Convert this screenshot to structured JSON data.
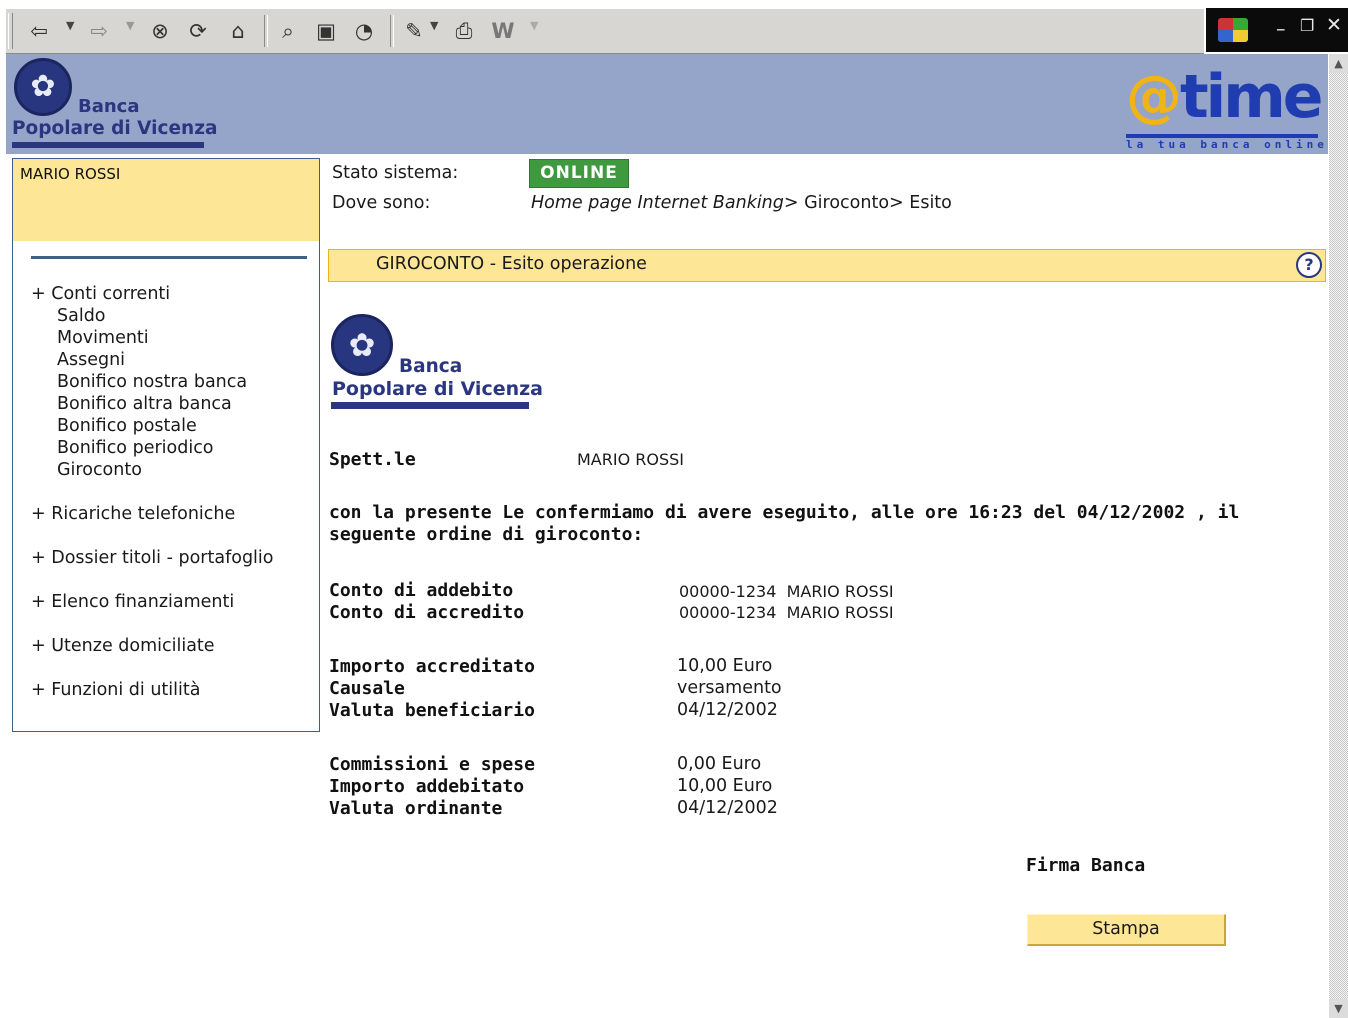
{
  "toolbar": {
    "icons": [
      "back-arrow-icon",
      "forward-arrow-icon",
      "stop-icon",
      "refresh-icon",
      "home-icon",
      "search-icon",
      "favorites-icon",
      "history-icon",
      "edit-icon",
      "print-icon",
      "word-icon"
    ]
  },
  "header": {
    "bank_word": "Banca",
    "bank_name": "Popolare di Vicenza",
    "brand_at": "@",
    "brand_time": "time",
    "brand_tagline": "la tua banca online"
  },
  "sidebar": {
    "user_name": "MARIO ROSSI",
    "groups": [
      {
        "label": "+ Conti correnti",
        "items": [
          "Saldo",
          "Movimenti",
          "Assegni",
          "Bonifico nostra banca",
          "Bonifico altra banca",
          "Bonifico postale",
          "Bonifico periodico",
          "Giroconto"
        ]
      },
      {
        "label": "+ Ricariche telefoniche"
      },
      {
        "label": "+ Dossier titoli - portafoglio"
      },
      {
        "label": "+ Elenco finanziamenti"
      },
      {
        "label": "+ Utenze domiciliate"
      },
      {
        "label": "+ Funzioni di utilità"
      }
    ]
  },
  "status": {
    "label": "Stato sistema:",
    "value": "ONLINE",
    "where_label": "Dove sono:",
    "crumb_home": "Home page Internet Banking",
    "crumb_sep1": "> Giroconto",
    "crumb_sep2": "> Esito"
  },
  "section": {
    "title": "GIROCONTO - Esito operazione",
    "help": "?"
  },
  "receipt": {
    "bank_word": "Banca",
    "bank_name": "Popolare di Vicenza",
    "spett_label": "Spett.le",
    "spett_value": "MARIO ROSSI",
    "message": "con la presente Le confermiamo di avere eseguito, alle ore 16:23 del 04/12/2002 , il seguente ordine di giroconto:",
    "conto_addebito_label": "Conto di addebito",
    "conto_addebito_value": "00000-1234  MARIO ROSSI",
    "conto_accredito_label": "Conto di accredito",
    "conto_accredito_value": "00000-1234  MARIO ROSSI",
    "importo_accreditato_label": "Importo accreditato",
    "importo_accreditato_value": "10,00 Euro",
    "causale_label": "Causale",
    "causale_value": "versamento",
    "valuta_beneficiario_label": "Valuta beneficiario",
    "valuta_beneficiario_value": "04/12/2002",
    "commissioni_label": "Commissioni e spese",
    "commissioni_value": "0,00 Euro",
    "importo_addebitato_label": "Importo addebitato",
    "importo_addebitato_value": "10,00 Euro",
    "valuta_ordinante_label": "Valuta ordinante",
    "valuta_ordinante_value": "04/12/2002",
    "firma": "Firma Banca",
    "stampa_button": "Stampa"
  },
  "colors": {
    "banner": "#95a4c9",
    "highlight": "#fde695",
    "online": "#3f9a3f",
    "navy": "#2a3680"
  }
}
